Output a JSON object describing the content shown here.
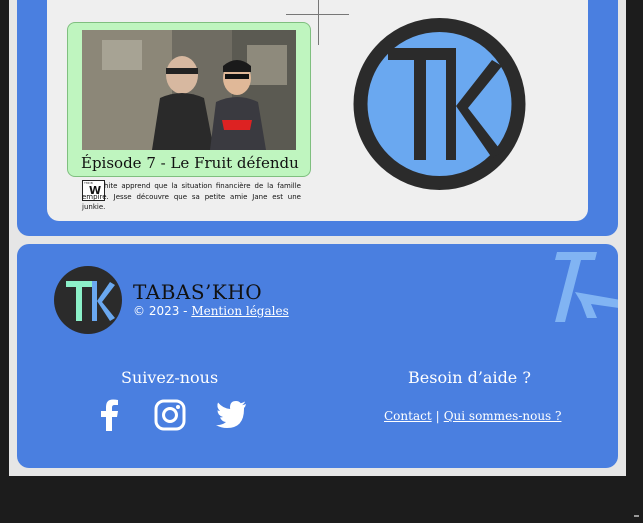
{
  "episode": {
    "title": "Épisode 7 - Le Fruit défendu",
    "rating": {
      "tag": "TMDB",
      "letter": "W",
      "sub": ""
    },
    "description": "hite apprend que la situation financière de la famille empire. Jesse découvre que sa petite amie Jane est une junkie."
  },
  "footer": {
    "brand": "TABAS’KHO",
    "copyright_prefix": "© 2023 - ",
    "legal_link": "Mention légales",
    "follow_title": "Suivez-nous",
    "help_title": "Besoin d’aide ?",
    "contact_link": "Contact",
    "separator": "|",
    "about_link": "Qui sommes-nous ?"
  },
  "icons": [
    "facebook-icon",
    "instagram-icon",
    "twitter-icon"
  ],
  "colors": {
    "accent_blue": "#4a7fe0",
    "logo_light_blue": "#6aa8f0",
    "card_green": "#bff5bf",
    "logo_dark": "#2b2b2b"
  }
}
